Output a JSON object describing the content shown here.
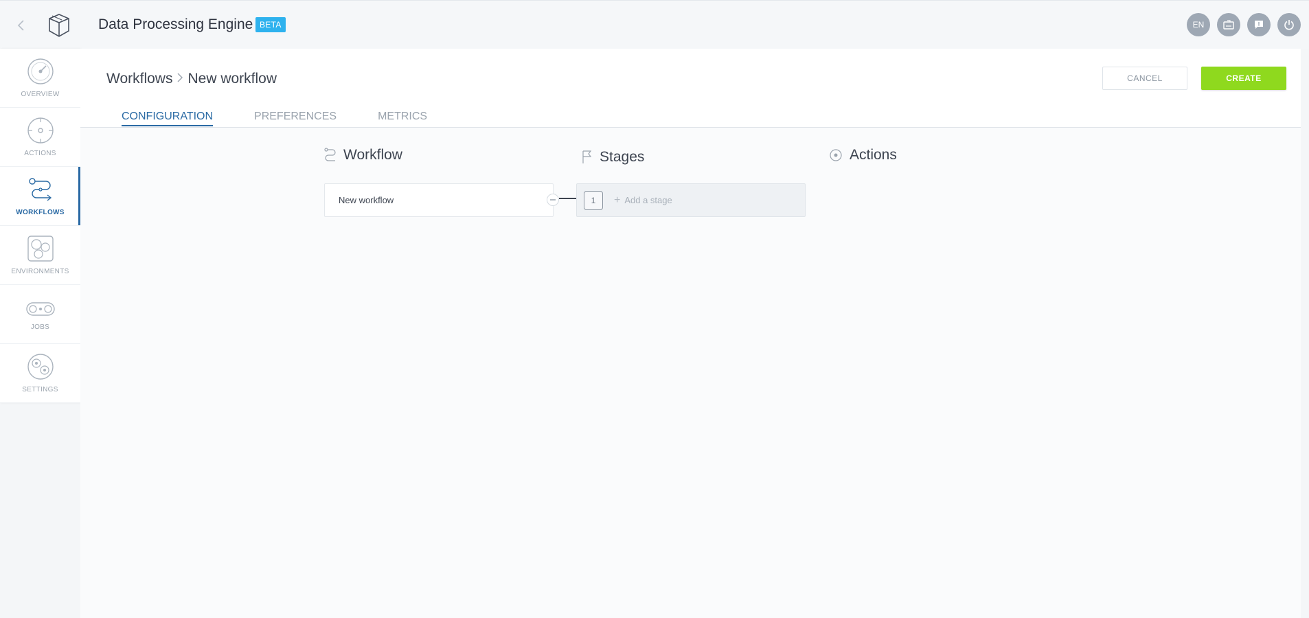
{
  "app": {
    "title": "Data Processing Engine",
    "badge": "BETA"
  },
  "header_icons": {
    "language": "EN"
  },
  "sidebar": {
    "items": [
      {
        "label": "OVERVIEW",
        "icon": "gauge-icon"
      },
      {
        "label": "ACTIONS",
        "icon": "target-icon"
      },
      {
        "label": "WORKFLOWS",
        "icon": "workflow-icon",
        "active": true
      },
      {
        "label": "ENVIRONMENTS",
        "icon": "environments-icon"
      },
      {
        "label": "JOBS",
        "icon": "conveyor-icon"
      },
      {
        "label": "SETTINGS",
        "icon": "gears-icon"
      }
    ]
  },
  "breadcrumb": {
    "parent": "Workflows",
    "current": "New workflow"
  },
  "buttons": {
    "cancel": "CANCEL",
    "create": "CREATE"
  },
  "tabs": [
    {
      "label": "CONFIGURATION",
      "active": true
    },
    {
      "label": "PREFERENCES"
    },
    {
      "label": "METRICS"
    }
  ],
  "columns": {
    "workflow": {
      "title": "Workflow",
      "item": "New workflow"
    },
    "stages": {
      "title": "Stages",
      "stage_number": "1",
      "add_label": "Add a stage"
    },
    "actions": {
      "title": "Actions"
    }
  },
  "colors": {
    "accent": "#2a6aa4",
    "create": "#8fd91e",
    "beta": "#2eb2ee"
  }
}
